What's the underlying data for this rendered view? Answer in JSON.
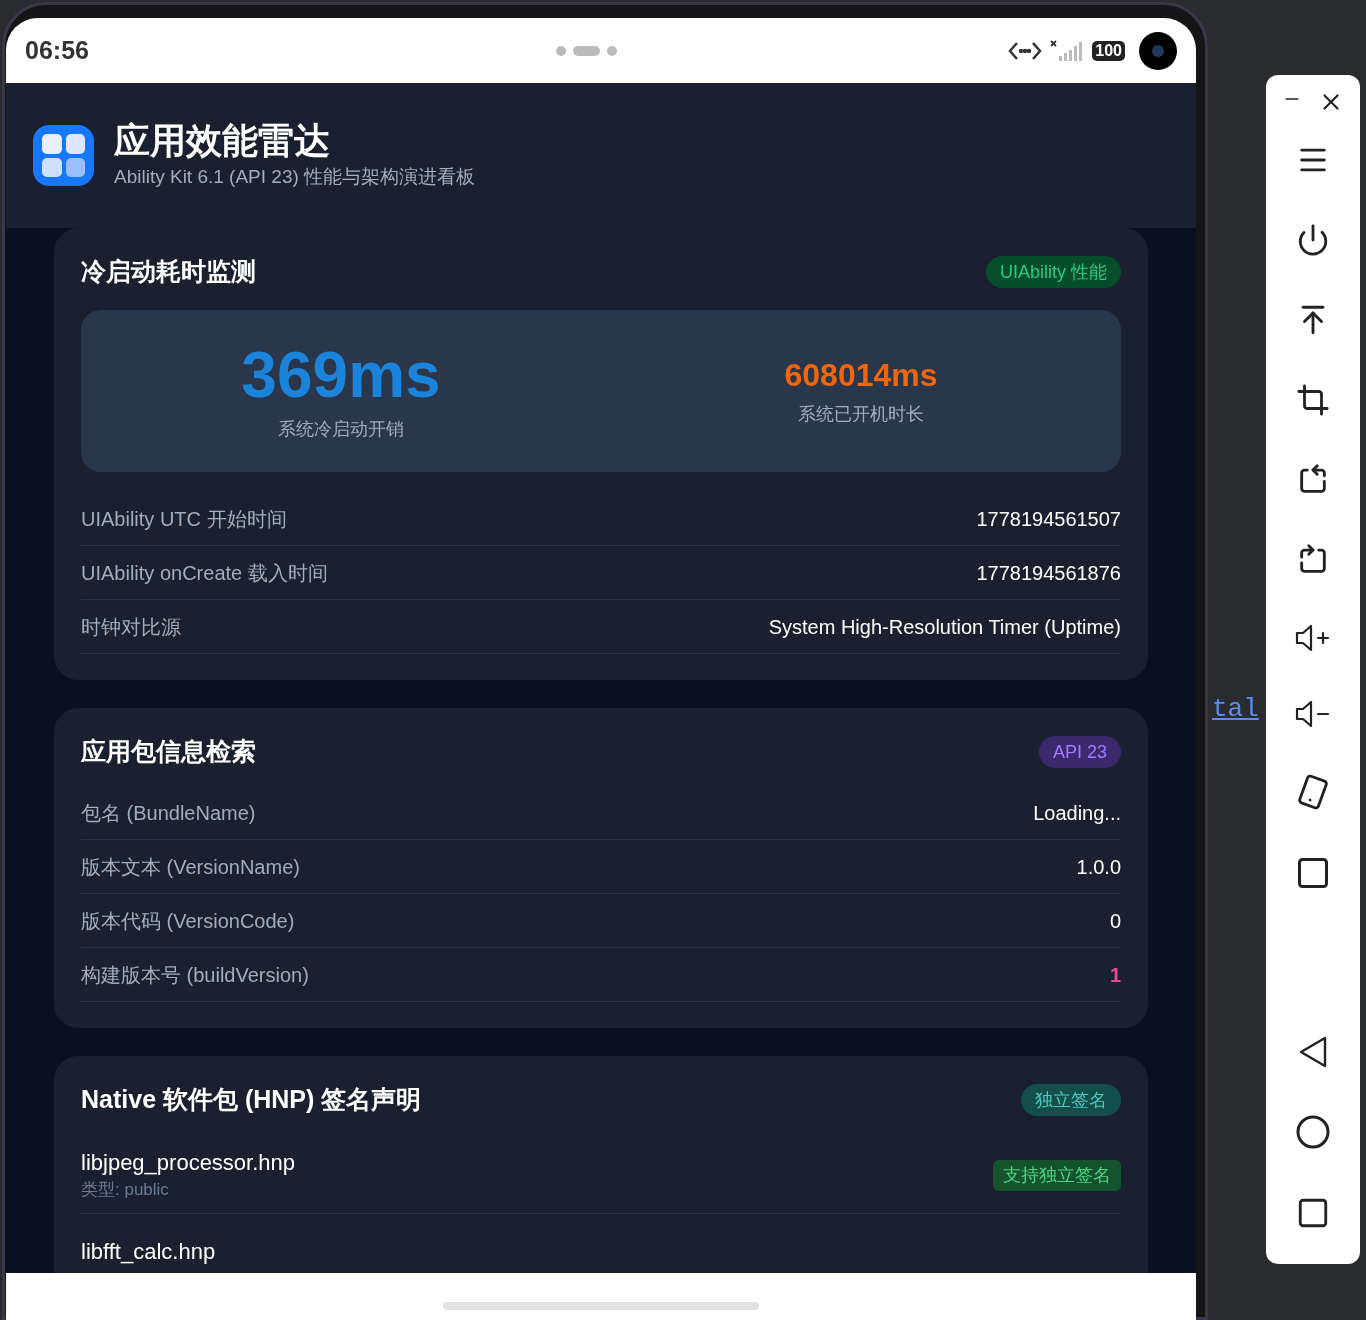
{
  "status_bar": {
    "time": "06:56",
    "battery": "100"
  },
  "header": {
    "title": "应用效能雷达",
    "subtitle": "Ability Kit 6.1 (API 23) 性能与架构演进看板"
  },
  "cards": [
    {
      "kind": "metrics",
      "title": "冷启动耗时监测",
      "badge": {
        "label": "UIAbility 性能",
        "color": "#064e2b"
      },
      "metrics": [
        {
          "value": "369ms",
          "label": "系统冷启动开销",
          "color": "#1a84dc"
        },
        {
          "value": "608014ms",
          "label": "系统已开机时长",
          "color": "#f0660f"
        }
      ],
      "rows": [
        {
          "label": "UIAbility UTC 开始时间",
          "value": "1778194561507",
          "kind": "plain"
        },
        {
          "label": "UIAbility onCreate 载入时间",
          "value": "1778194561876",
          "kind": "plain"
        },
        {
          "label": "时钟对比源",
          "value": "System High-Resolution Timer (Uptime)",
          "kind": "plain"
        }
      ]
    },
    {
      "kind": "info",
      "title": "应用包信息检索",
      "badge": {
        "label": "API 23",
        "color": "#3b2a6b"
      },
      "rows": [
        {
          "label": "包名 (BundleName)",
          "value": "Loading...",
          "kind": "plain"
        },
        {
          "label": "版本文本 (VersionName)",
          "value": "1.0.0",
          "kind": "plain"
        },
        {
          "label": "版本代码 (VersionCode)",
          "value": "0",
          "kind": "plain"
        },
        {
          "label": "构建版本号 (buildVersion)",
          "value": "1",
          "kind": "highlight"
        }
      ]
    },
    {
      "kind": "packages",
      "title": "Native 软件包 (HNP) 签名声明",
      "badge": {
        "label": "独立签名",
        "color": "#134e4a"
      },
      "packages": [
        {
          "name": "libjpeg_processor.hnp",
          "type": "类型: public",
          "badge": {
            "label": "支持独立签名",
            "color": "#14532d"
          }
        },
        {
          "name": "libfft_calc.hnp"
        }
      ]
    }
  ],
  "background_editor": {
    "text": "tal"
  }
}
